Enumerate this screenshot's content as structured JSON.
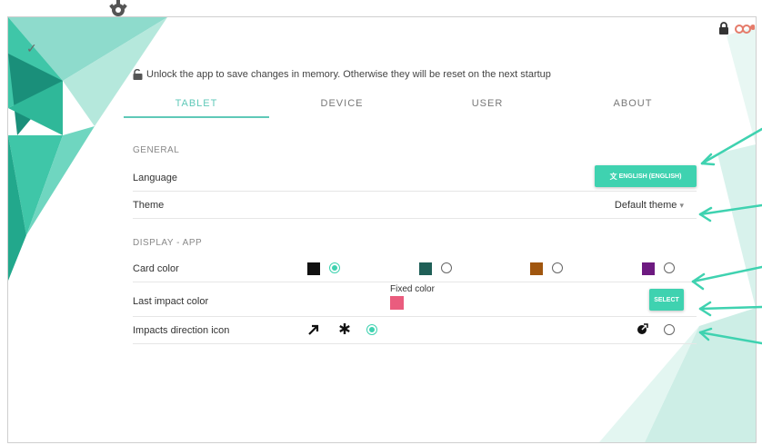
{
  "header": {
    "check_glyph": "✓"
  },
  "notice": {
    "text": "Unlock the app to save changes in memory. Otherwise they will be reset on the next startup"
  },
  "tabs": [
    {
      "label": "TABLET",
      "active": true
    },
    {
      "label": "DEVICE",
      "active": false
    },
    {
      "label": "USER",
      "active": false
    },
    {
      "label": "ABOUT",
      "active": false
    }
  ],
  "general": {
    "section_title": "GENERAL",
    "language_label": "Language",
    "language_button": "ENGLISH (ENGLISH)",
    "theme_label": "Theme",
    "theme_value": "Default theme",
    "theme_caret": "▾"
  },
  "display": {
    "section_title": "DISPLAY - APP",
    "card_color_label": "Card color",
    "card_colors": [
      {
        "color": "#111111",
        "selected": true
      },
      {
        "color": "#1f5f57",
        "selected": false
      },
      {
        "color": "#a0560f",
        "selected": false
      },
      {
        "color": "#6d1a80",
        "selected": false
      }
    ],
    "last_impact_label": "Last impact color",
    "fixed_color_label": "Fixed color",
    "fixed_color": "#ea5c7e",
    "select_button": "SELECT",
    "impacts_label": "Impacts direction icon",
    "impact_icons": [
      "arrow-icon",
      "asterisk-icon",
      "round-arrow-icon"
    ]
  },
  "colors": {
    "accent": "#3fd2b0",
    "tab_accent": "#5fc9b8"
  }
}
